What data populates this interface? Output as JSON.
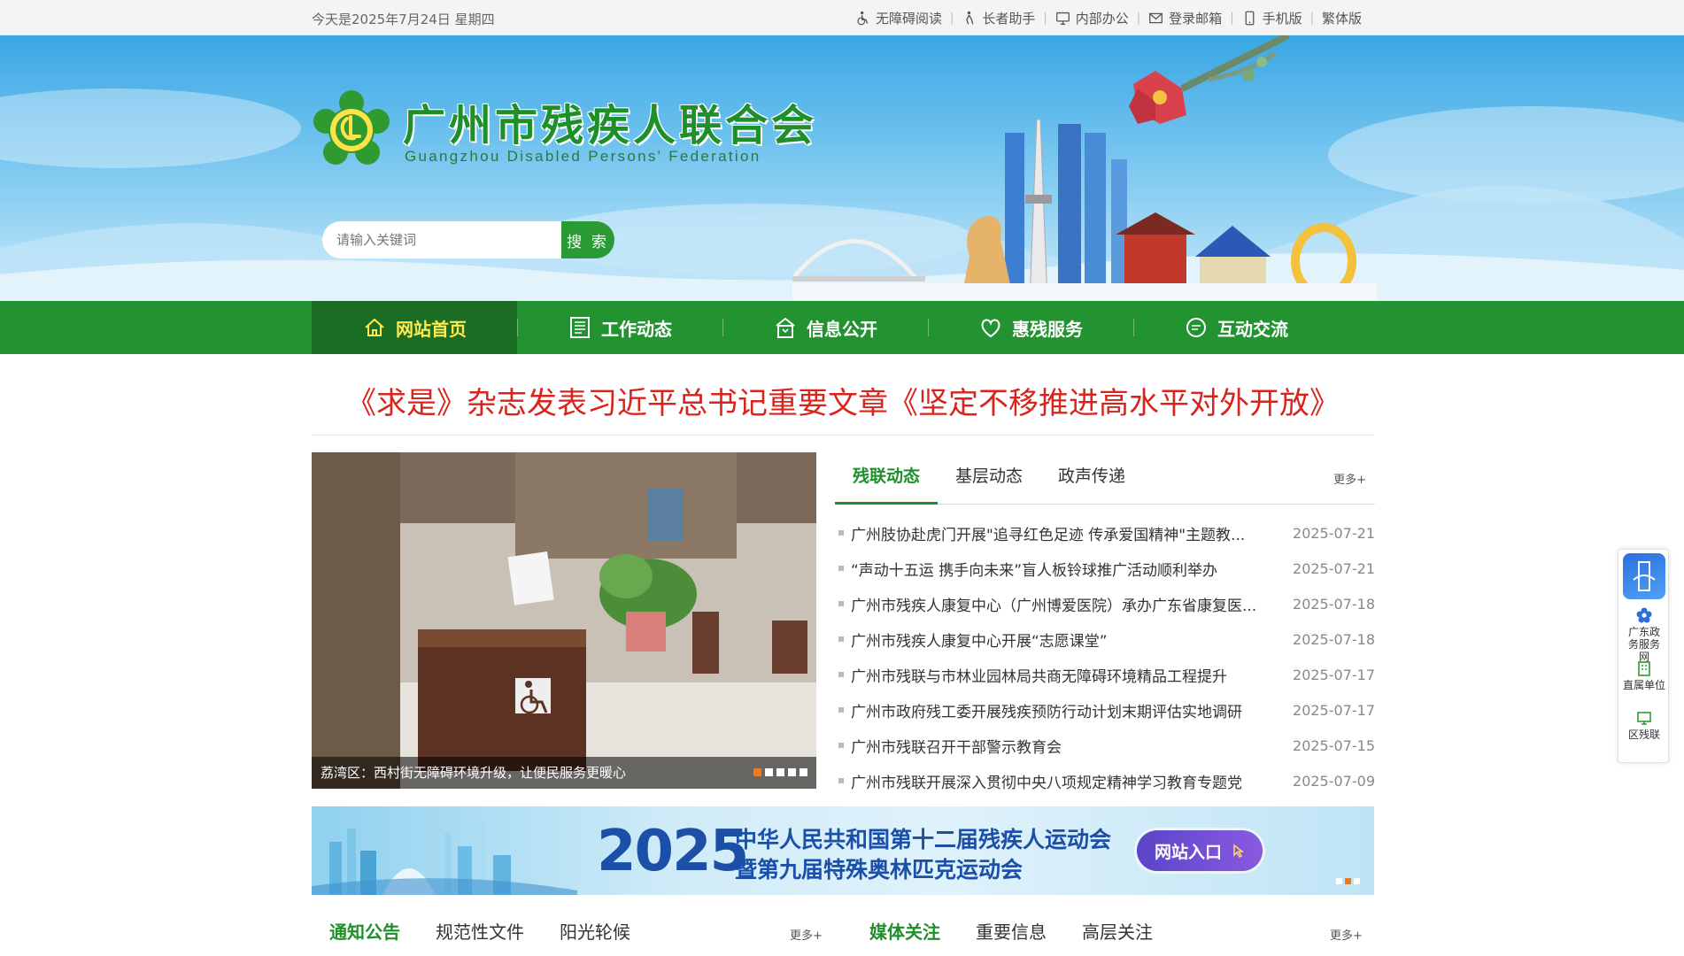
{
  "topbar": {
    "date": "今天是2025年7月24日 星期四",
    "links": [
      {
        "label": "无障碍阅读",
        "icon": "wheelchair-icon"
      },
      {
        "label": "长者助手",
        "icon": "elder-icon"
      },
      {
        "label": "内部办公",
        "icon": "monitor-icon"
      },
      {
        "label": "登录邮箱",
        "icon": "mail-icon"
      },
      {
        "label": "手机版",
        "icon": "phone-icon"
      },
      {
        "label": "繁体版",
        "icon": ""
      }
    ]
  },
  "header": {
    "title": "广州市残疾人联合会",
    "subtitle": "Guangzhou Disabled Persons' Federation",
    "search_placeholder": "请输入关键词",
    "search_button": "搜 索"
  },
  "nav": {
    "items": [
      {
        "label": "网站首页",
        "icon": "home-icon",
        "active": true
      },
      {
        "label": "工作动态",
        "icon": "newspaper-icon",
        "active": false
      },
      {
        "label": "信息公开",
        "icon": "building-icon",
        "active": false
      },
      {
        "label": "惠残服务",
        "icon": "heart-icon",
        "active": false
      },
      {
        "label": "互动交流",
        "icon": "chat-icon",
        "active": false
      }
    ]
  },
  "headline": "《求是》杂志发表习近平总书记重要文章《坚定不移推进高水平对外开放》",
  "carousel": {
    "caption": "荔湾区：西村街无障碍环境升级，让便民服务更暖心",
    "slides": 5,
    "active_slide": 1
  },
  "news": {
    "tabs": [
      "残联动态",
      "基层动态",
      "政声传递"
    ],
    "active_tab": 0,
    "more": "更多+",
    "items": [
      {
        "title": "广州肢协赴虎门开展\"追寻红色足迹 传承爱国精神\"主题教...",
        "date": "2025-07-21"
      },
      {
        "title": "“声动十五运 携手向未来”盲人板铃球推广活动顺利举办",
        "date": "2025-07-21"
      },
      {
        "title": "广州市残疾人康复中心（广州博爱医院）承办广东省康复医...",
        "date": "2025-07-18"
      },
      {
        "title": "广州市残疾人康复中心开展“志愿课堂”",
        "date": "2025-07-18"
      },
      {
        "title": "广州市残联与市林业园林局共商无障碍环境精品工程提升",
        "date": "2025-07-17"
      },
      {
        "title": "广州市政府残工委开展残疾预防行动计划末期评估实地调研",
        "date": "2025-07-17"
      },
      {
        "title": "广州市残联召开干部警示教育会",
        "date": "2025-07-15"
      },
      {
        "title": "广州市残联开展深入贯彻中央八项规定精神学习教育专题党",
        "date": "2025-07-09"
      }
    ]
  },
  "event_banner": {
    "year": "2025",
    "line1": "中华人民共和国第十二届残疾人运动会",
    "line2": "暨第九届特殊奥林匹克运动会",
    "button": "网站入口"
  },
  "bottom_left": {
    "tabs": [
      "通知公告",
      "规范性文件",
      "阳光轮候"
    ],
    "more": "更多+"
  },
  "bottom_right": {
    "tabs": [
      "媒体关注",
      "重要信息",
      "高层关注"
    ],
    "more": "更多+"
  },
  "float_bar": {
    "items": [
      {
        "label": "广东政务服务网",
        "icon": "flower-icon"
      },
      {
        "label": "直属单位",
        "icon": "office-building-icon"
      },
      {
        "label": "区残联",
        "icon": "screen-icon"
      }
    ]
  },
  "colors": {
    "brand_green": "#239230",
    "active_nav": "#1a6d23",
    "headline_red": "#d7241c",
    "accent_orange": "#f07a1a"
  }
}
